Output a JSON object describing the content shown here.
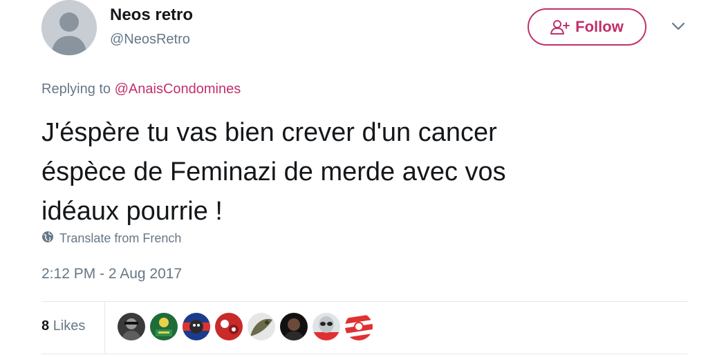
{
  "author": {
    "display_name": "Neos retro",
    "handle": "@NeosRetro"
  },
  "follow_button": {
    "label": "Follow",
    "icon": "add-user-icon"
  },
  "menu": {
    "icon": "chevron-down-icon"
  },
  "reply": {
    "prefix": "Replying to",
    "mention": "@AnaisCondomines"
  },
  "tweet": {
    "lines": [
      "J'éspère tu vas bien crever d'un cancer",
      "éspèce de Feminazi de merde avec vos",
      "idéaux pourrie !"
    ]
  },
  "translate": {
    "label": "Translate from French",
    "icon": "globe-icon"
  },
  "timestamp": "2:12 PM - 2 Aug 2017",
  "likes": {
    "count": "8",
    "label": "Likes",
    "likers": [
      {
        "name": "liker-avatar-1",
        "colors": [
          "#3a3a3a",
          "#9a9a9a"
        ]
      },
      {
        "name": "liker-avatar-2",
        "colors": [
          "#1f6b3a",
          "#e8d24a"
        ]
      },
      {
        "name": "liker-avatar-3",
        "colors": [
          "#1b3c8c",
          "#e03131"
        ]
      },
      {
        "name": "liker-avatar-4",
        "colors": [
          "#c92a2a",
          "#ffffff"
        ]
      },
      {
        "name": "liker-avatar-5",
        "colors": [
          "#6b6b4a",
          "#e6e6e6"
        ]
      },
      {
        "name": "liker-avatar-6",
        "colors": [
          "#111111",
          "#6b4a3a"
        ]
      },
      {
        "name": "liker-avatar-7",
        "colors": [
          "#e03131",
          "#dfe4e8"
        ]
      },
      {
        "name": "liker-avatar-8",
        "colors": [
          "#e03131",
          "#ffffff"
        ]
      }
    ]
  },
  "colors": {
    "accent": "#c0306b",
    "secondary_text": "#657786",
    "primary_text": "#14171a",
    "divider": "#e1e8ed"
  }
}
